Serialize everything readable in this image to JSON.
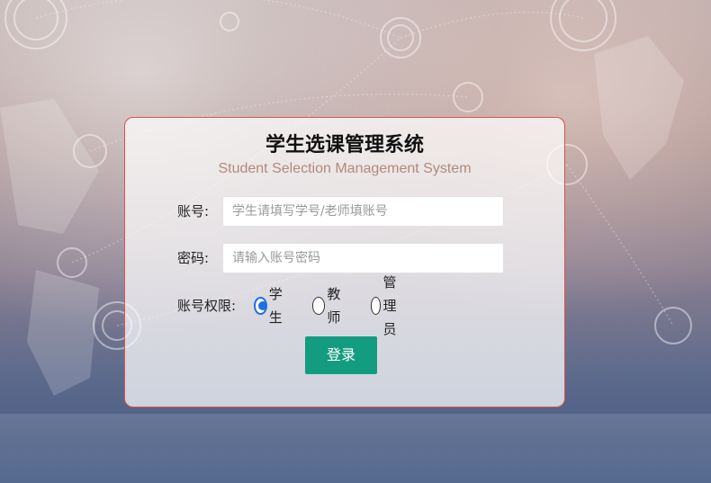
{
  "app": {
    "title": "学生选课管理系统",
    "subtitle": "Student Selection Management System"
  },
  "form": {
    "account_label": "账号:",
    "account_placeholder": "学生请填写学号/老师填账号",
    "password_label": "密码:",
    "password_placeholder": "请输入账号密码",
    "role_label": "账号权限:",
    "roles": [
      {
        "label": "学生",
        "checked": true
      },
      {
        "label": "教师",
        "checked": false
      },
      {
        "label": "管理员",
        "checked": false
      }
    ],
    "login_label": "登录"
  },
  "colors": {
    "accent": "#149c80",
    "radio_checked": "#1e6fe0",
    "card_border": "#d9534f",
    "subtitle": "#b08a7a"
  }
}
